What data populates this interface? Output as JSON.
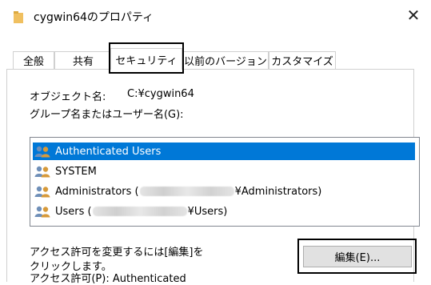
{
  "window": {
    "title": "cygwin64のプロパティ",
    "close_symbol": "✕"
  },
  "tabs": [
    {
      "label": "全般",
      "selected": false
    },
    {
      "label": "共有",
      "selected": false
    },
    {
      "label": "セキュリティ",
      "selected": true
    },
    {
      "label": "以前のバージョン",
      "selected": false
    },
    {
      "label": "カスタマイズ",
      "selected": false
    }
  ],
  "security": {
    "object_name_label": "オブジェクト名:",
    "object_name_value": "C:¥cygwin64",
    "group_label": "グループ名またはユーザー名(G):",
    "users": [
      {
        "name": "Authenticated Users",
        "selected": true
      },
      {
        "name": "SYSTEM",
        "selected": false
      },
      {
        "name_prefix": "Administrators (",
        "name_suffix": "¥Administrators)",
        "selected": false
      },
      {
        "name_prefix": "Users (",
        "name_suffix": "¥Users)",
        "selected": false
      }
    ],
    "change_text_line1": "アクセス許可を変更するには[編集]を",
    "change_text_line2": "クリックします。",
    "edit_button": "編集(E)...",
    "permissions_label": "アクセス許可(P): Authenticated"
  },
  "colors": {
    "selection": "#0078d7",
    "folder": "#f0c060"
  },
  "icons": {
    "folder": "folder-icon",
    "close": "close-icon",
    "user_group": "user-group-icon"
  }
}
